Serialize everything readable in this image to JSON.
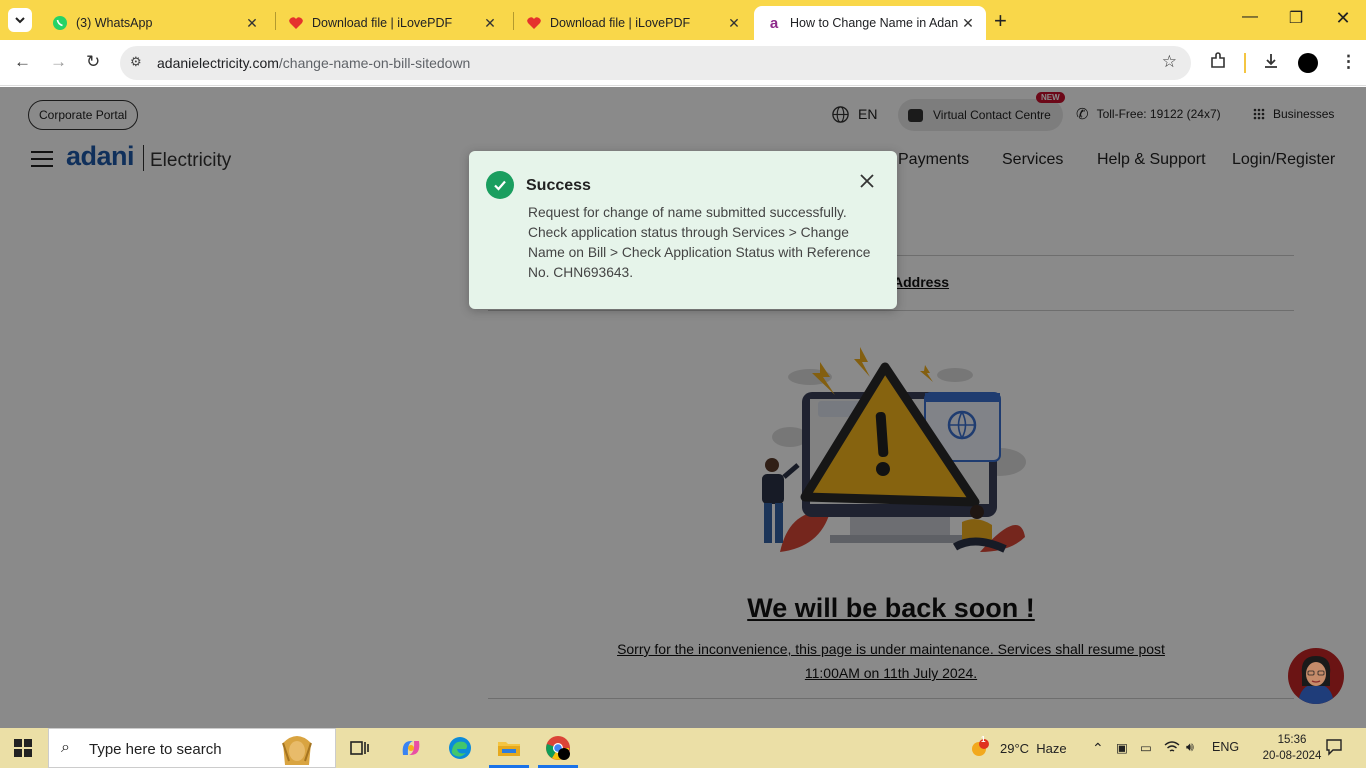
{
  "browser": {
    "tabs": [
      {
        "title": "(3) WhatsApp",
        "active": false
      },
      {
        "title": "Download file | iLovePDF",
        "active": false
      },
      {
        "title": "Download file | iLovePDF",
        "active": false
      },
      {
        "title": "How to Change Name in Adani",
        "active": true
      }
    ],
    "url_host": "adanielectricity.com",
    "url_path": "/change-name-on-bill-sitedown"
  },
  "header": {
    "corporate_portal": "Corporate Portal",
    "language": "EN",
    "virtual_contact": "Virtual Contact Centre",
    "new_badge": "NEW",
    "toll_free": "Toll-Free: 19122 (24x7)",
    "businesses": "Businesses",
    "logo_brand": "adani",
    "logo_sub": "Electricity",
    "nav": [
      "Payments",
      "Services",
      "Help & Support",
      "Login/Register"
    ]
  },
  "main": {
    "address_link": "Address",
    "heading": "We will be back soon !",
    "message": "Sorry for the inconvenience, this page is under maintenance. Services shall resume post 11:00AM on 11th July 2024."
  },
  "toast": {
    "title": "Success",
    "message": "Request for change of name submitted successfully. Check application status through Services > Change Name on Bill > Check Application Status with Reference No. CHN693643."
  },
  "taskbar": {
    "search_placeholder": "Type here to search",
    "weather": "29°C  Haze",
    "lang": "ENG",
    "time": "15:36",
    "date": "20-08-2024",
    "weather_badge": "1"
  },
  "colors": {
    "tabbar": "#f9d74a",
    "success_bg": "#e6f4ea",
    "success_icon": "#1a9e5f",
    "adani_blue": "#1e5aa8"
  }
}
